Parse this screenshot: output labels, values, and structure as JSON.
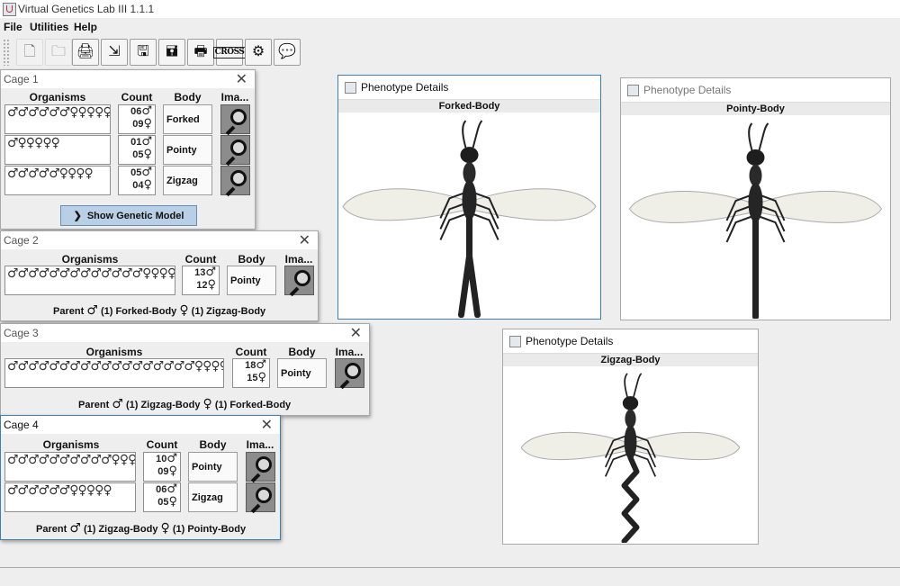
{
  "app": {
    "title": "Virtual Genetics Lab III 1.1.1"
  },
  "menu": [
    "File",
    "Utilities",
    "Help"
  ],
  "toolbar": {
    "buttons": [
      {
        "name": "new-cage-icon",
        "glyph": "🗋",
        "disabled": true
      },
      {
        "name": "open-folder-icon",
        "glyph": "🗀",
        "disabled": true
      },
      {
        "name": "open-problem-icon",
        "glyph": "🖨",
        "disabled": false
      },
      {
        "name": "exit-icon",
        "glyph": "⇲",
        "disabled": false
      },
      {
        "name": "save-icon",
        "glyph": "🖫",
        "disabled": false
      },
      {
        "name": "save-as-icon",
        "glyph": "🖬",
        "disabled": false
      },
      {
        "name": "print-icon",
        "glyph": "🖶",
        "disabled": false
      },
      {
        "name": "cross-icon",
        "glyph": "CROSS",
        "disabled": false
      },
      {
        "name": "model-icon",
        "glyph": "⚙",
        "disabled": false
      },
      {
        "name": "about-icon",
        "glyph": "💬",
        "disabled": false
      }
    ]
  },
  "headers": {
    "organisms": "Organisms",
    "count": "Count",
    "body": "Body",
    "image": "Ima..."
  },
  "cage1": {
    "title": "Cage 1",
    "rows": [
      {
        "organisms": "♂♂♂♂♂♂♀♀♀♀♀♀♀♀♀",
        "male": "06",
        "female": "09",
        "body": "Forked"
      },
      {
        "organisms": "♂♀♀♀♀♀",
        "male": "01",
        "female": "05",
        "body": "Pointy"
      },
      {
        "organisms": "♂♂♂♂♂♀♀♀♀",
        "male": "05",
        "female": "04",
        "body": "Zigzag"
      }
    ],
    "button": "Show Genetic Model"
  },
  "cage2": {
    "title": "Cage 2",
    "rows": [
      {
        "organisms": "♂♂♂♂♂♂♂♂♂♂♂♂♂♀♀♀♀♀♀♀♀♀♀♀♀",
        "male": "13",
        "female": "12",
        "body": "Pointy"
      }
    ],
    "parent": {
      "label": "Parent",
      "male": "(1) Forked-Body",
      "female": "(1) Zigzag-Body"
    }
  },
  "cage3": {
    "title": "Cage 3",
    "rows": [
      {
        "organisms": "♂♂♂♂♂♂♂♂♂♂♂♂♂♂♂♂♂♂♀♀♀♀♀♀♀♀♀♀♀♀♀♀♀",
        "male": "18",
        "female": "15",
        "body": "Pointy"
      }
    ],
    "parent": {
      "label": "Parent",
      "male": "(1) Zigzag-Body",
      "female": "(1) Forked-Body"
    }
  },
  "cage4": {
    "title": "Cage 4",
    "rows": [
      {
        "organisms": "♂♂♂♂♂♂♂♂♂♂♀♀♀♀♀♀♀♀♀",
        "male": "10",
        "female": "09",
        "body": "Pointy"
      },
      {
        "organisms": "♂♂♂♂♂♂♀♀♀♀♀",
        "male": "06",
        "female": "05",
        "body": "Zigzag"
      }
    ],
    "parent": {
      "label": "Parent",
      "male": "(1) Zigzag-Body",
      "female": "(1) Pointy-Body"
    }
  },
  "symbols": {
    "male": "♂",
    "female": "♀"
  },
  "phenotype_windows": [
    {
      "title": "Phenotype Details",
      "label": "Forked-Body",
      "body_type": "forked"
    },
    {
      "title": "Phenotype Details",
      "label": "Pointy-Body",
      "body_type": "pointy"
    },
    {
      "title": "Phenotype Details",
      "label": "Zigzag-Body",
      "body_type": "zigzag"
    }
  ]
}
